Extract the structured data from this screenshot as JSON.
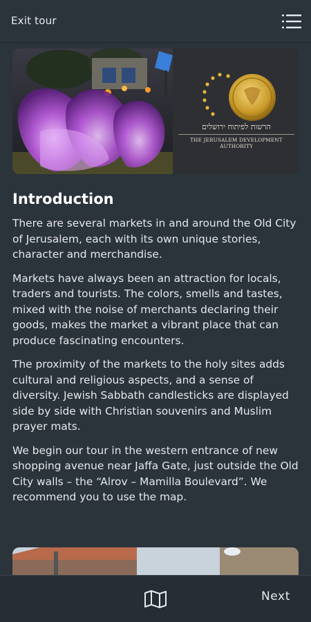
{
  "header": {
    "exit_label": "Exit tour",
    "menu_icon": "list-menu-icon"
  },
  "hero": {
    "logo_hebrew": "הרשות לפיתוח ירושלים",
    "logo_english": "THE JERUSALEM DEVELOPMENT AUTHORITY"
  },
  "main": {
    "title": "Introduction",
    "paragraphs": [
      "There are several markets in and around the Old City of Jerusalem, each with its own unique stories, character and merchandise.",
      "Markets have always been an attraction for locals, traders and tourists. The colors, smells and tastes, mixed with the noise of merchants declaring their goods, makes the market a vibrant place that can produce fascinating encounters.",
      "The proximity of the markets to the holy sites adds cultural and religious aspects, and a sense of diversity. Jewish Sabbath candlesticks are displayed side by side with Christian souvenirs and Muslim prayer mats.",
      "We begin our tour in the western entrance of new shopping avenue near Jaffa Gate, just outside the Old City walls – the “Alrov – Mamilla Boulevard”. We recommend you to use the map."
    ]
  },
  "footer": {
    "map_icon": "map-icon",
    "next_label": "Next"
  },
  "colors": {
    "background": "#2b333b",
    "bottom_bar": "#262d34",
    "text": "#e8ebee"
  }
}
